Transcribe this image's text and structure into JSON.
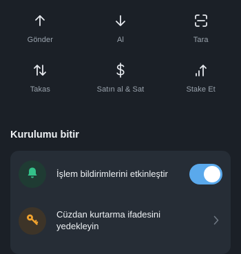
{
  "actions": [
    {
      "label": "Gönder",
      "icon": "arrow-up-icon"
    },
    {
      "label": "Al",
      "icon": "arrow-down-icon"
    },
    {
      "label": "Tara",
      "icon": "scan-icon"
    },
    {
      "label": "Takas",
      "icon": "swap-icon"
    },
    {
      "label": "Satın al & Sat",
      "icon": "dollar-icon"
    },
    {
      "label": "Stake Et",
      "icon": "stake-icon"
    }
  ],
  "setup": {
    "title": "Kurulumu bitir",
    "items": [
      {
        "label": "İşlem bildirimlerini etkinleştir",
        "icon": "bell-icon",
        "toggle_on": true
      },
      {
        "label": "Cüzdan kurtarma ifadesini yedekleyin",
        "icon": "key-icon"
      }
    ]
  },
  "colors": {
    "background": "#1b2027",
    "card": "#262d36",
    "toggle_on": "#5aa9ec",
    "bell": "#34c28a",
    "key": "#f0a22e"
  }
}
